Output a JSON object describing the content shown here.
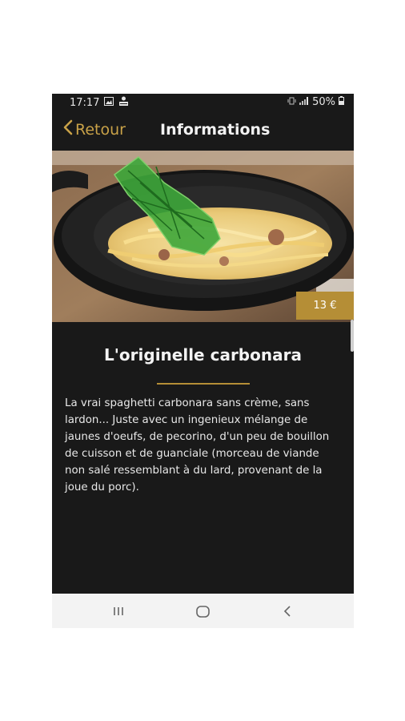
{
  "status_bar": {
    "time": "17:17",
    "battery": "50%",
    "icons_left": [
      "image-icon",
      "notification-person-icon"
    ],
    "icons_right": [
      "vibrate-icon",
      "signal-icon",
      "battery-icon"
    ]
  },
  "nav": {
    "back_label": "Retour",
    "title": "Informations",
    "accent_color": "#c9a248"
  },
  "dish": {
    "price": "13 €",
    "name": "L'originelle carbonara",
    "description": "La vrai spaghetti carbonara sans crème, sans lardon... Juste avec un ingenieux mélange de jaunes d'oeufs, de pecorino, d'un peu de bouillon de cuisson et de guanciale (morceau de viande non salé ressemblant à du lard, provenant de la joue du porc)."
  },
  "colors": {
    "background": "#191919",
    "gold": "#b58e36",
    "text": "#f3f3f3"
  },
  "system_nav": {
    "buttons": [
      "recents-icon",
      "home-icon",
      "back-icon"
    ]
  }
}
